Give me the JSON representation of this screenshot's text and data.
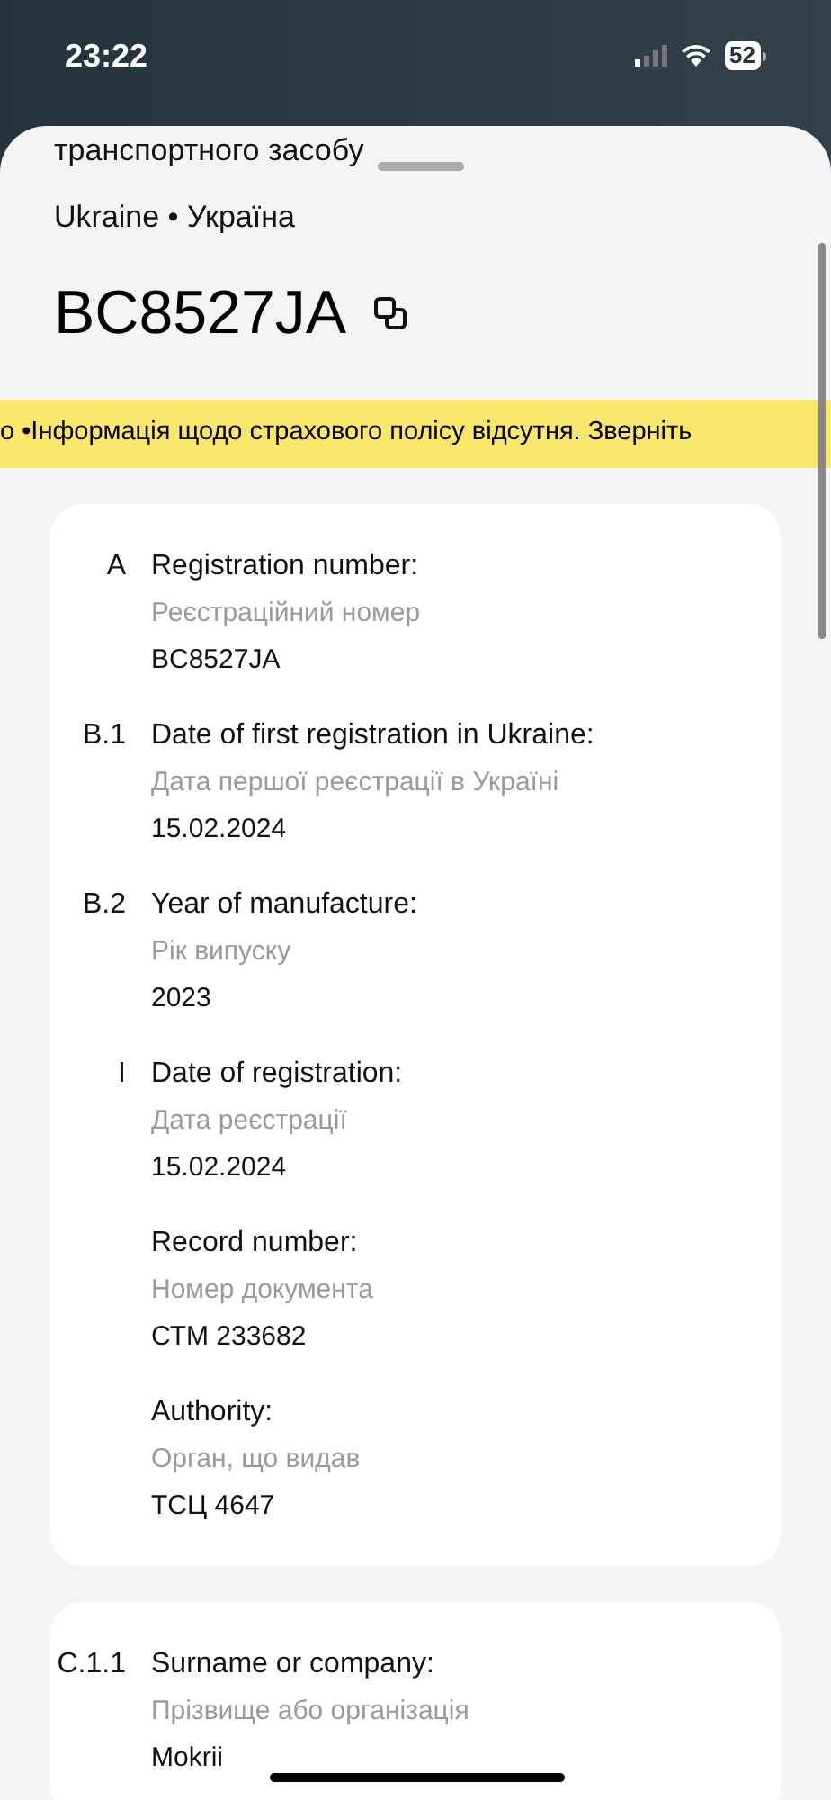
{
  "status_bar": {
    "time": "23:22",
    "battery": "52"
  },
  "sheet": {
    "title": "транспортного засобу",
    "country": "Ukraine • Україна",
    "plate": "BC8527JA"
  },
  "banner": "о •Інформація щодо страхового полісу відсутня. Зверніть",
  "cards": [
    {
      "fields": [
        {
          "code": "A",
          "label": "Registration number:",
          "label_uk": "Реєстраційний номер",
          "values": [
            "BC8527JA"
          ]
        },
        {
          "code": "B.1",
          "label": "Date of first registration in Ukraine:",
          "label_uk": "Дата першої реєстрації в Україні",
          "values": [
            "15.02.2024"
          ]
        },
        {
          "code": "B.2",
          "label": "Year of manufacture:",
          "label_uk": "Рік випуску",
          "values": [
            "2023"
          ]
        },
        {
          "code": "I",
          "label": "Date of registration:",
          "label_uk": "Дата реєстрації",
          "values": [
            "15.02.2024"
          ]
        },
        {
          "label": "Record number:",
          "label_uk": "Номер документа",
          "values": [
            "СТМ 233682"
          ]
        },
        {
          "label": "Authority:",
          "label_uk": "Орган, що видав",
          "values": [
            "ТСЦ 4647"
          ]
        }
      ]
    },
    {
      "fields": [
        {
          "code": "C.1.1",
          "label": "Surname or company:",
          "label_uk": "Прізвище або організація",
          "values": [
            "Mokrii"
          ]
        }
      ]
    }
  ]
}
